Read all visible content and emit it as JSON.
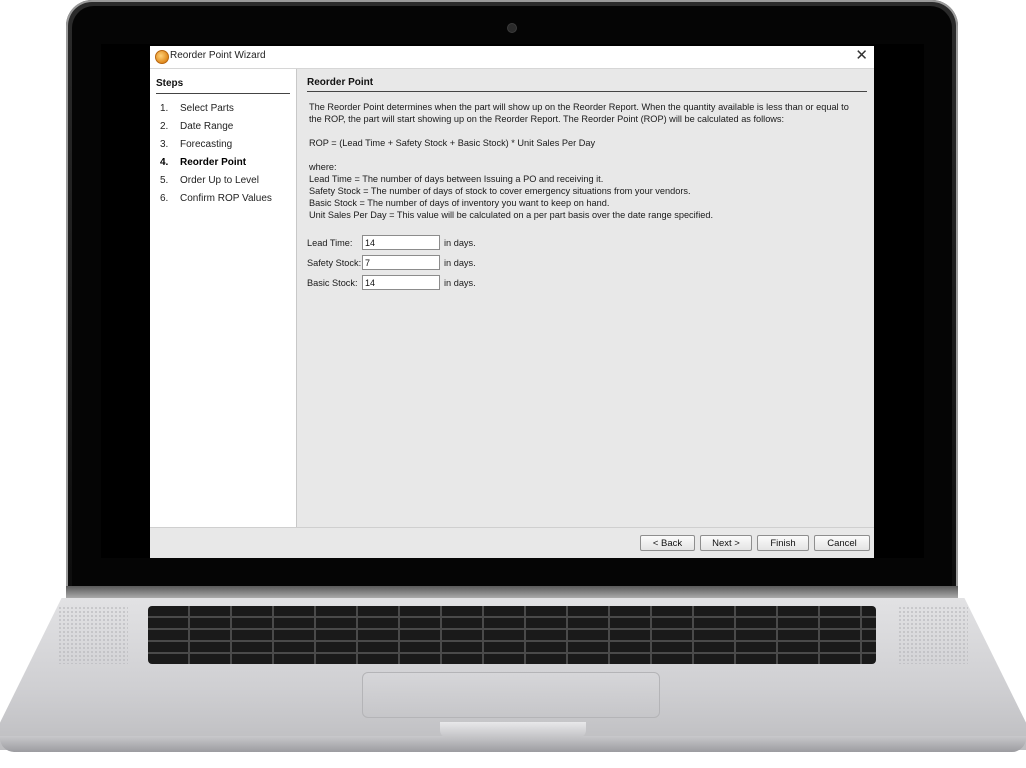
{
  "window": {
    "title": "Reorder Point Wizard",
    "close_glyph": "✕"
  },
  "steps": {
    "heading": "Steps",
    "items": [
      {
        "num": "1.",
        "label": "Select Parts"
      },
      {
        "num": "2.",
        "label": "Date Range"
      },
      {
        "num": "3.",
        "label": "Forecasting"
      },
      {
        "num": "4.",
        "label": "Reorder Point",
        "active": true
      },
      {
        "num": "5.",
        "label": "Order Up to Level"
      },
      {
        "num": "6.",
        "label": "Confirm ROP Values"
      }
    ]
  },
  "content": {
    "heading": "Reorder Point",
    "intro_line1": "The Reorder Point determines when the part will show up on the Reorder Report.  When the quantity available is less than or equal to",
    "intro_line2": "the ROP, the part will start showing up on the Reorder Report.  The Reorder Point (ROP) will be calculated as follows:",
    "formula": "ROP = (Lead Time + Safety Stock + Basic Stock) * Unit Sales Per Day",
    "where": "where:",
    "def_lead": "Lead Time = The number of days between Issuing a PO and receiving it.",
    "def_safety": "Safety Stock = The number of days of stock to cover emergency situations from your vendors.",
    "def_basic": "Basic Stock = The number of days of inventory you want to keep on hand.",
    "def_unit": "Unit Sales Per Day = This value will be calculated on a per part basis over the date range specified."
  },
  "fields": {
    "lead_time": {
      "label": "Lead Time:",
      "value": "14",
      "unit": "in days."
    },
    "safety_stock": {
      "label": "Safety Stock:",
      "value": "7",
      "unit": "in days."
    },
    "basic_stock": {
      "label": "Basic Stock:",
      "value": "14",
      "unit": "in days."
    }
  },
  "buttons": {
    "back": "< Back",
    "next": "Next >",
    "finish": "Finish",
    "cancel": "Cancel"
  }
}
